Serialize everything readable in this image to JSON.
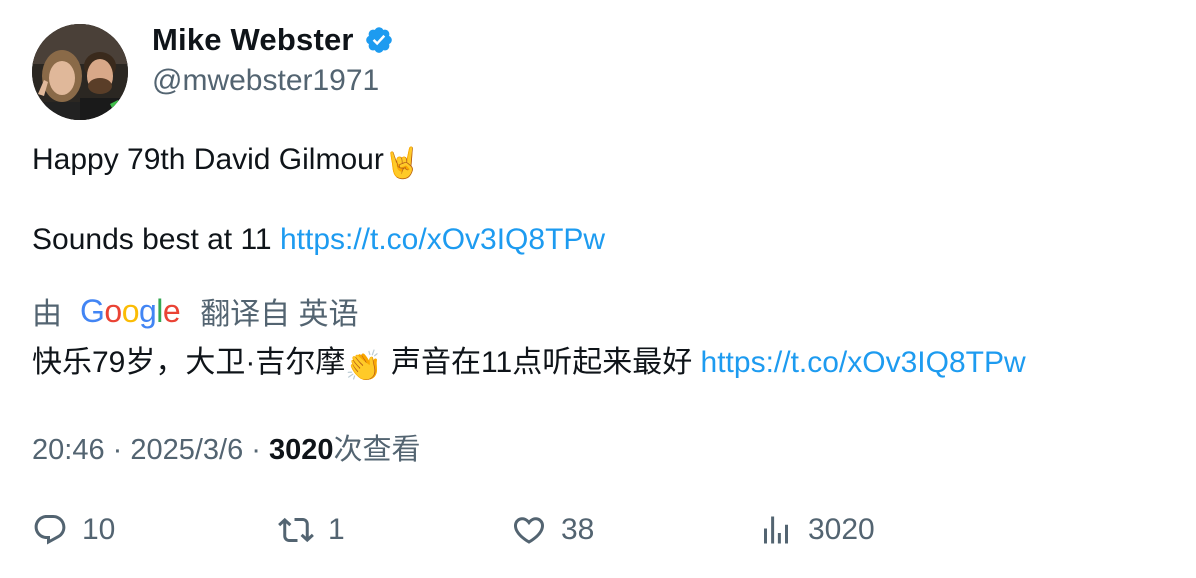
{
  "author": {
    "name": "Mike Webster",
    "handle": "@mwebster1971",
    "verified_color": "#1d9bf0"
  },
  "tweet": {
    "line1_text": "Happy 79th David Gilmour",
    "line1_emoji": "🤘",
    "line2_text": "Sounds best at 11 ",
    "link": "https://t.co/xOv3IQ8TPw"
  },
  "translation": {
    "prefix": "由",
    "google": [
      "G",
      "o",
      "o",
      "g",
      "l",
      "e"
    ],
    "suffix": "翻译自 英语",
    "text_part1": "快乐79岁，大卫·吉尔摩",
    "emoji": "👏",
    "text_part2": " 声音在11点听起来最好 ",
    "link": "https://t.co/xOv3IQ8TPw"
  },
  "meta": {
    "time": "20:46",
    "sep": " · ",
    "date": "2025/3/6",
    "views_count": "3020",
    "views_label": "次查看"
  },
  "actions": {
    "replies": "10",
    "retweets": "1",
    "likes": "38",
    "views": "3020"
  },
  "colors": {
    "link": "#1d9bf0",
    "muted": "#536471",
    "text": "#0f1419"
  }
}
